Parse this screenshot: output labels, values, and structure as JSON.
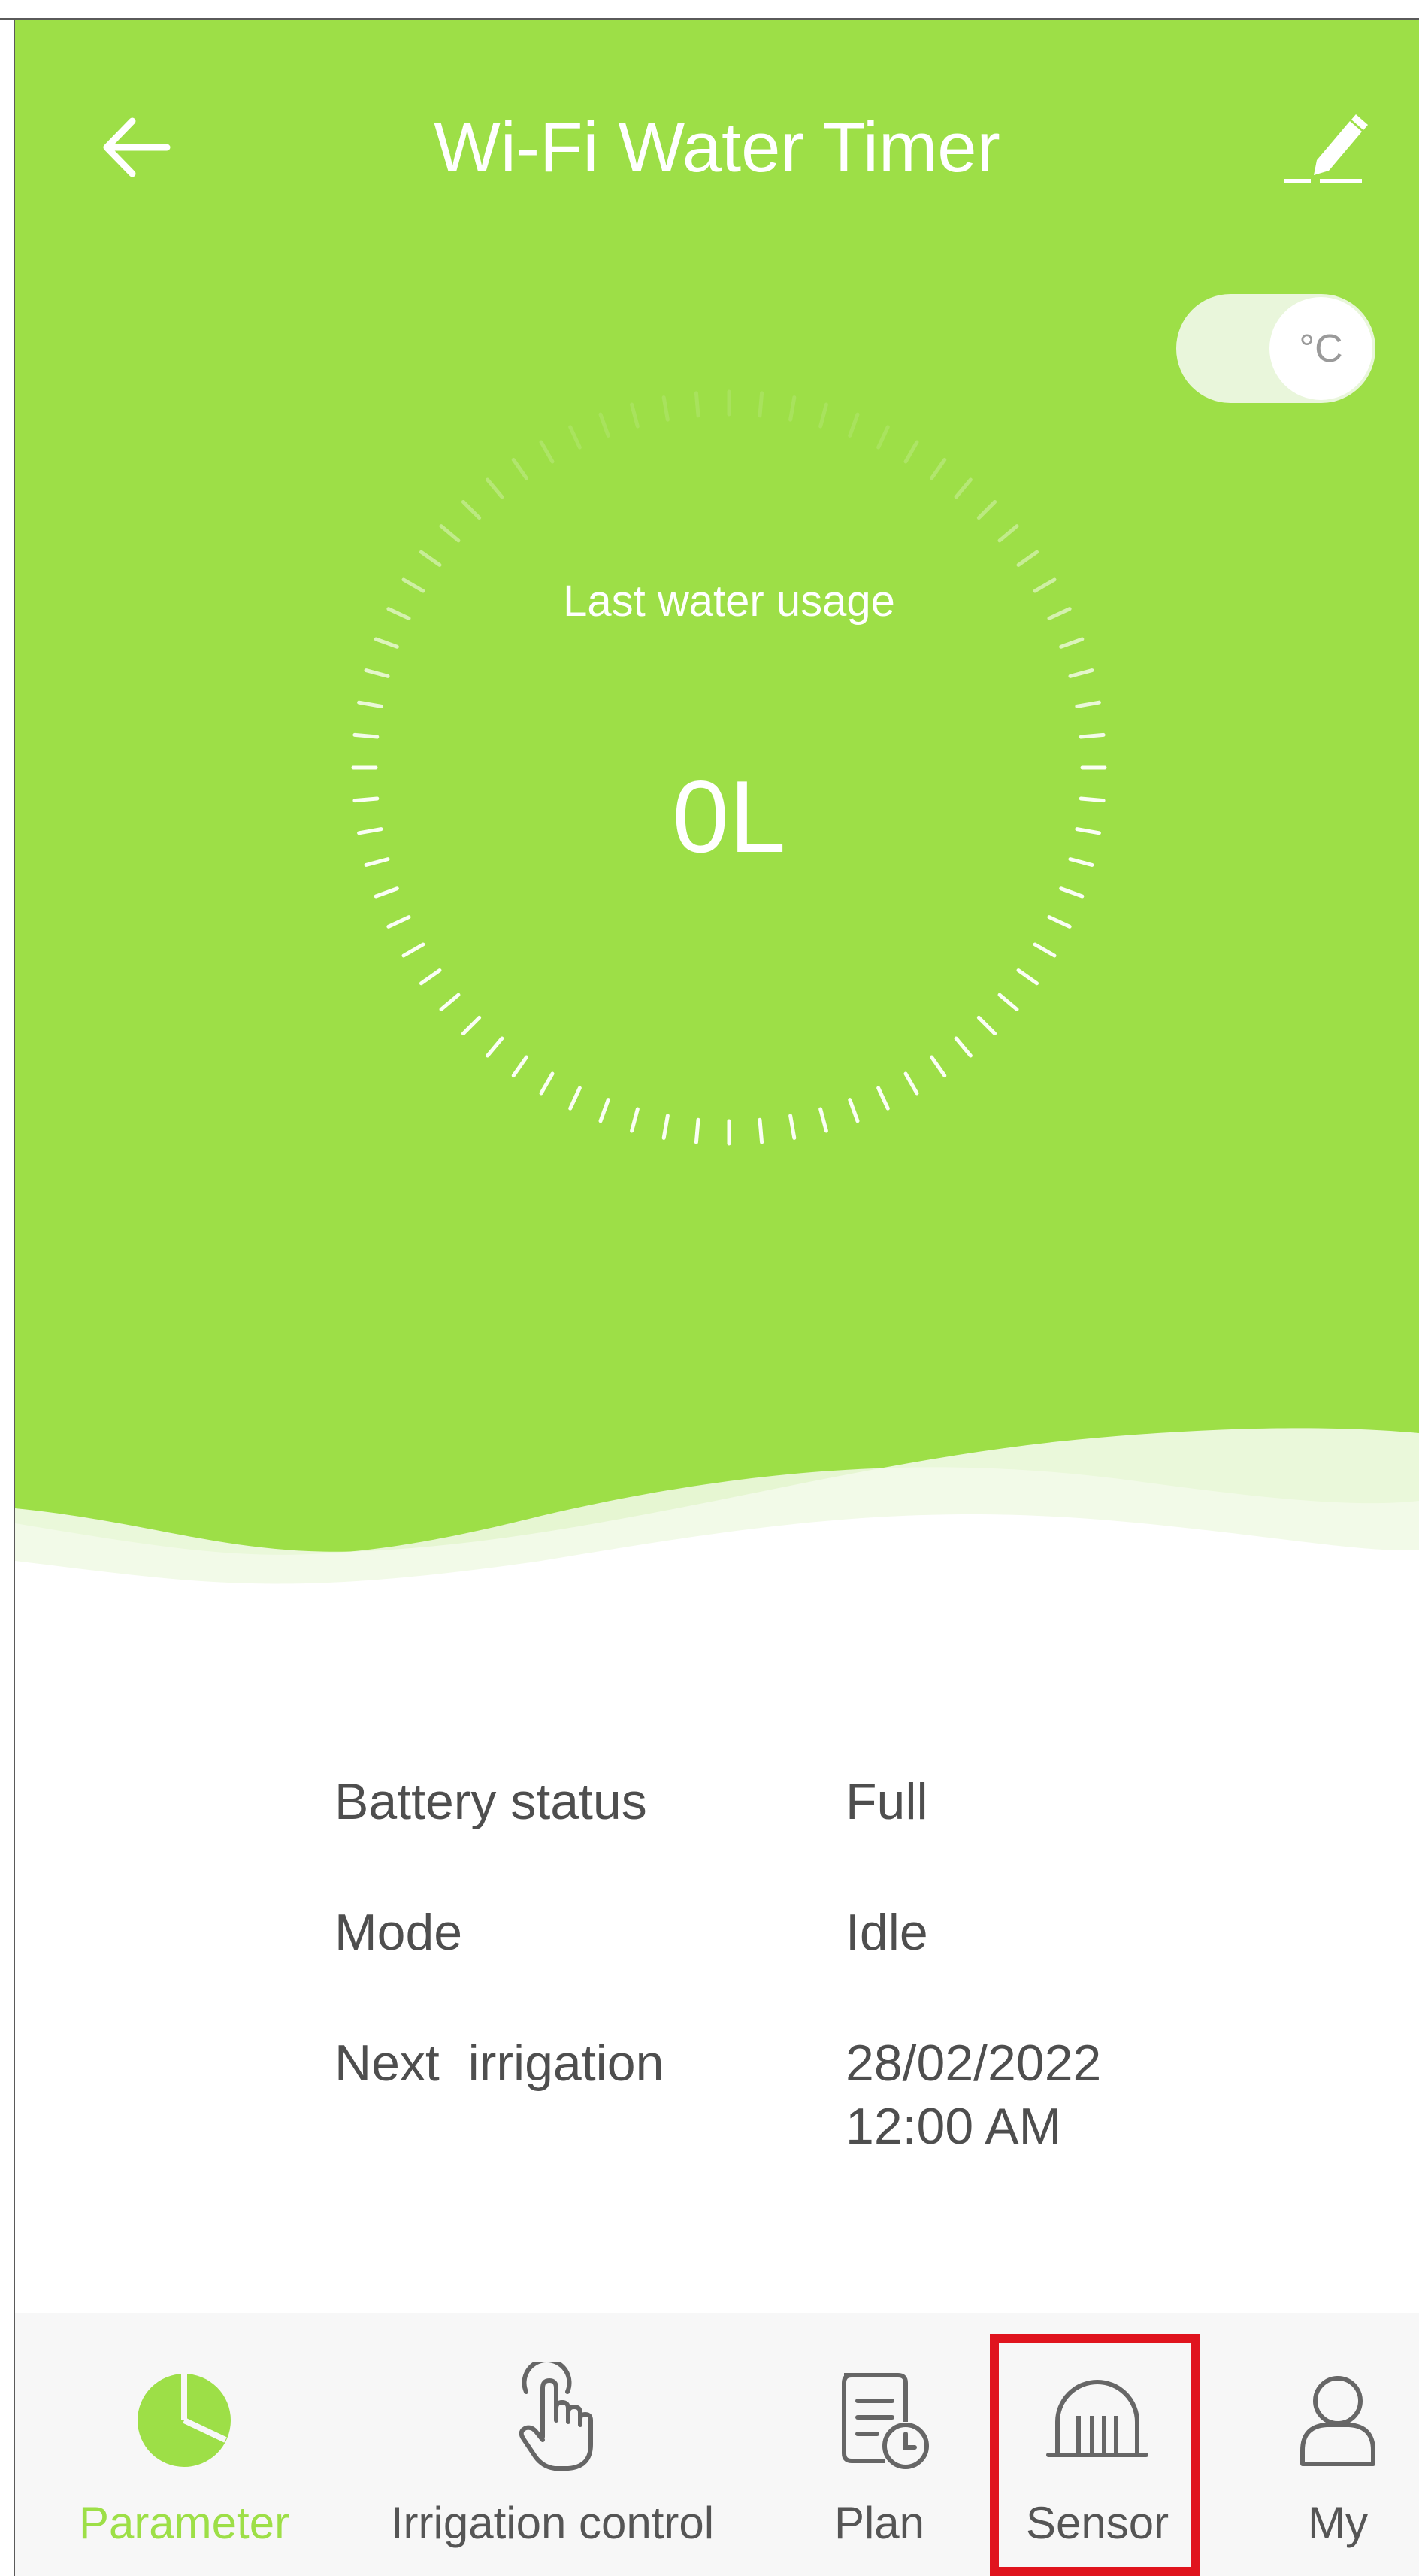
{
  "header": {
    "title": "Wi-Fi Water Timer",
    "background_color": "#9ddf47",
    "back_icon": "arrow-left-icon",
    "edit_icon": "pencil-icon"
  },
  "unit_toggle": {
    "unit_label": "°C"
  },
  "gauge": {
    "label": "Last water usage",
    "value": "0L"
  },
  "info": {
    "rows": [
      {
        "label": "Battery status",
        "value": "Full"
      },
      {
        "label": "Mode",
        "value": "Idle"
      },
      {
        "label": "Next  irrigation",
        "value_line1": "28/02/2022",
        "value_line2": "12:00 AM"
      }
    ]
  },
  "tabbar": {
    "accent_color": "#9ddf47",
    "tabs": [
      {
        "label": "Parameter",
        "icon": "pie-chart-icon",
        "active": true
      },
      {
        "label": "Irrigation control",
        "icon": "hand-pointer-icon",
        "active": false
      },
      {
        "label": "Plan",
        "icon": "schedule-document-icon",
        "active": false
      },
      {
        "label": "Sensor",
        "icon": "sensor-dome-icon",
        "active": false,
        "highlighted": true
      },
      {
        "label": "My",
        "icon": "user-icon",
        "active": false
      }
    ]
  }
}
